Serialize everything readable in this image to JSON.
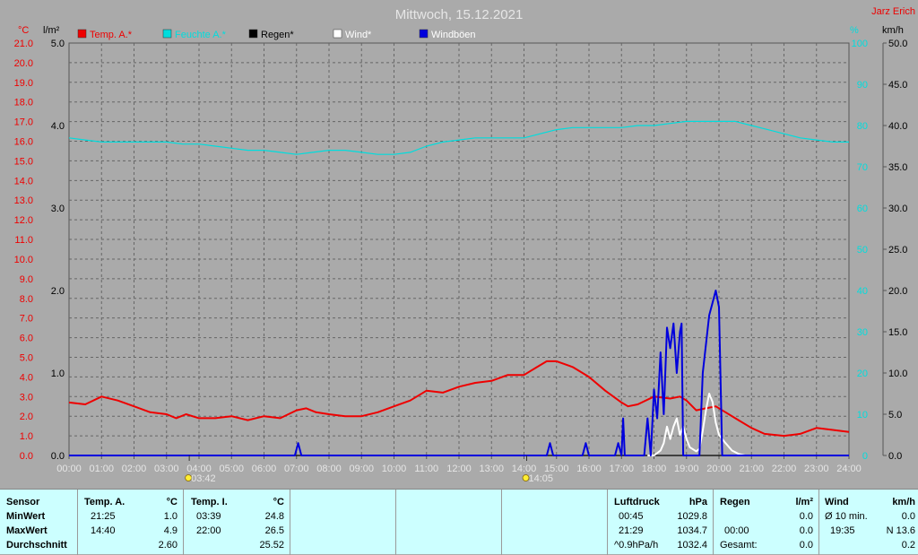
{
  "title": "Mittwoch, 15.12.2021",
  "owner": "Jarz Erich",
  "colors": {
    "temp": "#ee0000",
    "humidity": "#00dddd",
    "rain": "#000000",
    "wind": "#ffffff",
    "gust": "#0000dd"
  },
  "chart_data": {
    "type": "line",
    "x_ticks": [
      "00:00",
      "01:00",
      "02:00",
      "03:00",
      "04:00",
      "05:00",
      "06:00",
      "07:00",
      "08:00",
      "09:00",
      "10:00",
      "11:00",
      "12:00",
      "13:00",
      "14:00",
      "15:00",
      "16:00",
      "17:00",
      "18:00",
      "19:00",
      "20:00",
      "21:00",
      "22:00",
      "23:00",
      "24:00"
    ],
    "axes": {
      "temp": {
        "unit": "°C",
        "range": [
          0,
          21
        ],
        "ticks": [
          "0.0",
          "1.0",
          "2.0",
          "3.0",
          "4.0",
          "5.0",
          "6.0",
          "7.0",
          "8.0",
          "9.0",
          "10.0",
          "11.0",
          "12.0",
          "13.0",
          "14.0",
          "15.0",
          "16.0",
          "17.0",
          "18.0",
          "19.0",
          "20.0",
          "21.0"
        ]
      },
      "rain": {
        "unit": "l/m²",
        "range": [
          0,
          5
        ],
        "ticks": [
          "0.0",
          "1.0",
          "2.0",
          "3.0",
          "4.0",
          "5.0"
        ]
      },
      "humidity": {
        "unit": "%",
        "range": [
          0,
          100
        ],
        "ticks": [
          "0",
          "10",
          "20",
          "30",
          "40",
          "50",
          "60",
          "70",
          "80",
          "90",
          "100"
        ]
      },
      "wind": {
        "unit": "km/h",
        "range": [
          0,
          50
        ],
        "ticks": [
          "0.0",
          "5.0",
          "10.0",
          "15.0",
          "20.0",
          "25.0",
          "30.0",
          "35.0",
          "40.0",
          "45.0",
          "50.0"
        ]
      }
    },
    "grid": true,
    "legend_position": "top",
    "series": [
      {
        "name": "Temp. A.*",
        "axis": "temp",
        "color": "#ee0000",
        "points": [
          [
            0,
            2.7
          ],
          [
            0.5,
            2.6
          ],
          [
            1,
            3.0
          ],
          [
            1.5,
            2.8
          ],
          [
            2,
            2.5
          ],
          [
            2.5,
            2.2
          ],
          [
            3,
            2.1
          ],
          [
            3.3,
            1.9
          ],
          [
            3.6,
            2.1
          ],
          [
            4,
            1.9
          ],
          [
            4.5,
            1.9
          ],
          [
            5,
            2.0
          ],
          [
            5.5,
            1.8
          ],
          [
            6,
            2.0
          ],
          [
            6.5,
            1.9
          ],
          [
            7,
            2.3
          ],
          [
            7.3,
            2.4
          ],
          [
            7.6,
            2.2
          ],
          [
            8,
            2.1
          ],
          [
            8.5,
            2.0
          ],
          [
            9,
            2.0
          ],
          [
            9.5,
            2.2
          ],
          [
            10,
            2.5
          ],
          [
            10.5,
            2.8
          ],
          [
            11,
            3.3
          ],
          [
            11.5,
            3.2
          ],
          [
            12,
            3.5
          ],
          [
            12.5,
            3.7
          ],
          [
            13,
            3.8
          ],
          [
            13.5,
            4.1
          ],
          [
            14,
            4.1
          ],
          [
            14.4,
            4.5
          ],
          [
            14.7,
            4.8
          ],
          [
            15,
            4.8
          ],
          [
            15.5,
            4.5
          ],
          [
            16,
            4.0
          ],
          [
            16.5,
            3.3
          ],
          [
            17,
            2.7
          ],
          [
            17.2,
            2.5
          ],
          [
            17.5,
            2.6
          ],
          [
            18,
            3.0
          ],
          [
            18.5,
            2.9
          ],
          [
            18.8,
            3.0
          ],
          [
            19,
            2.8
          ],
          [
            19.3,
            2.3
          ],
          [
            19.6,
            2.4
          ],
          [
            19.9,
            2.5
          ],
          [
            20.2,
            2.2
          ],
          [
            20.6,
            1.8
          ],
          [
            21,
            1.4
          ],
          [
            21.4,
            1.1
          ],
          [
            22,
            1.0
          ],
          [
            22.5,
            1.1
          ],
          [
            23,
            1.4
          ],
          [
            23.5,
            1.3
          ],
          [
            24,
            1.2
          ]
        ]
      },
      {
        "name": "Feuchte A.*",
        "axis": "humidity",
        "color": "#00dddd",
        "points": [
          [
            0,
            77
          ],
          [
            0.5,
            76.5
          ],
          [
            1,
            76
          ],
          [
            1.5,
            76
          ],
          [
            2,
            76
          ],
          [
            2.5,
            76
          ],
          [
            3,
            76
          ],
          [
            3.5,
            75.5
          ],
          [
            4,
            75.5
          ],
          [
            4.5,
            75
          ],
          [
            5,
            74.5
          ],
          [
            5.5,
            74
          ],
          [
            6,
            74
          ],
          [
            6.5,
            73.5
          ],
          [
            7,
            73
          ],
          [
            7.5,
            73.5
          ],
          [
            8,
            74
          ],
          [
            8.5,
            74
          ],
          [
            9,
            73.5
          ],
          [
            9.5,
            73
          ],
          [
            10,
            73
          ],
          [
            10.5,
            73.5
          ],
          [
            11,
            75
          ],
          [
            11.5,
            76
          ],
          [
            12,
            76.5
          ],
          [
            12.5,
            77
          ],
          [
            13,
            77
          ],
          [
            13.5,
            77
          ],
          [
            14,
            77
          ],
          [
            14.5,
            78
          ],
          [
            15,
            79
          ],
          [
            15.5,
            79.5
          ],
          [
            16,
            79.5
          ],
          [
            16.5,
            79.5
          ],
          [
            17,
            79.5
          ],
          [
            17.5,
            80
          ],
          [
            18,
            80
          ],
          [
            18.5,
            80.5
          ],
          [
            19,
            81
          ],
          [
            19.5,
            81
          ],
          [
            20,
            81
          ],
          [
            20.5,
            81
          ],
          [
            21,
            80
          ],
          [
            21.5,
            79
          ],
          [
            22,
            78
          ],
          [
            22.5,
            77
          ],
          [
            23,
            76.5
          ],
          [
            23.5,
            76
          ],
          [
            24,
            76
          ]
        ]
      },
      {
        "name": "Regen*",
        "axis": "rain",
        "color": "#000000",
        "points": [
          [
            0,
            0
          ],
          [
            24,
            0
          ]
        ]
      },
      {
        "name": "Wind*",
        "axis": "wind",
        "color": "#ffffff",
        "points": [
          [
            17.8,
            0
          ],
          [
            18.0,
            0
          ],
          [
            18.2,
            0.6
          ],
          [
            18.3,
            1.5
          ],
          [
            18.4,
            3.5
          ],
          [
            18.5,
            2.0
          ],
          [
            18.6,
            3.5
          ],
          [
            18.7,
            4.5
          ],
          [
            18.8,
            2.5
          ],
          [
            18.9,
            3.5
          ],
          [
            19.0,
            2.0
          ],
          [
            19.1,
            1.0
          ],
          [
            19.3,
            0.5
          ],
          [
            19.4,
            0.8
          ],
          [
            19.5,
            3.0
          ],
          [
            19.6,
            5.5
          ],
          [
            19.7,
            7.5
          ],
          [
            19.8,
            6.5
          ],
          [
            19.9,
            4.0
          ],
          [
            20.0,
            2.5
          ],
          [
            20.2,
            1.5
          ],
          [
            20.4,
            0.6
          ],
          [
            20.6,
            0.2
          ],
          [
            20.8,
            0
          ],
          [
            21,
            0
          ]
        ]
      },
      {
        "name": "Windböen",
        "axis": "wind",
        "color": "#0000dd",
        "points": [
          [
            0,
            0
          ],
          [
            6.95,
            0
          ],
          [
            7.05,
            1.5
          ],
          [
            7.15,
            0
          ],
          [
            14.7,
            0
          ],
          [
            14.8,
            1.5
          ],
          [
            14.9,
            0
          ],
          [
            15.8,
            0
          ],
          [
            15.9,
            1.5
          ],
          [
            16.0,
            0
          ],
          [
            16.8,
            0
          ],
          [
            16.9,
            1.5
          ],
          [
            17.0,
            0
          ],
          [
            17.05,
            4.5
          ],
          [
            17.1,
            0
          ],
          [
            17.7,
            0
          ],
          [
            17.8,
            4.5
          ],
          [
            17.9,
            0
          ],
          [
            18.0,
            8.0
          ],
          [
            18.1,
            4.5
          ],
          [
            18.2,
            12.5
          ],
          [
            18.3,
            5.0
          ],
          [
            18.4,
            15.5
          ],
          [
            18.5,
            13.0
          ],
          [
            18.6,
            16.0
          ],
          [
            18.7,
            10.0
          ],
          [
            18.8,
            15.0
          ],
          [
            18.85,
            16.0
          ],
          [
            18.9,
            0
          ],
          [
            19.4,
            0
          ],
          [
            19.5,
            10.0
          ],
          [
            19.6,
            13.5
          ],
          [
            19.7,
            17.0
          ],
          [
            19.8,
            18.5
          ],
          [
            19.9,
            20.0
          ],
          [
            20.0,
            18.0
          ],
          [
            20.1,
            0
          ],
          [
            24,
            0
          ]
        ]
      }
    ],
    "markers": [
      {
        "x": 3.7,
        "label": "03:42"
      },
      {
        "x": 14.083,
        "label": "14:05"
      }
    ]
  },
  "stats": {
    "sensor": {
      "header": "Sensor",
      "rows": [
        "MinWert",
        "MaxWert",
        "Durchschnitt"
      ]
    },
    "temp_a": {
      "header": "Temp. A.",
      "unit": "°C",
      "min_time": "21:25",
      "min": "1.0",
      "max_time": "14:40",
      "max": "4.9",
      "avg": "2.60"
    },
    "temp_i": {
      "header": "Temp. I.",
      "unit": "°C",
      "min_time": "03:39",
      "min": "24.8",
      "max_time": "22:00",
      "max": "26.5",
      "avg": "25.52"
    },
    "pressure": {
      "header": "Luftdruck",
      "unit": "hPa",
      "min_time": "00:45",
      "min": "1029.8",
      "max_time": "21:29",
      "max": "1034.7",
      "trend": "^0.9hPa/h",
      "trend_value": "1032.4"
    },
    "rain": {
      "header": "Regen",
      "unit": "l/m²",
      "blank": "",
      "value1": "0.0",
      "time2": "00:00",
      "value2": "0.0",
      "label3": "Gesamt:",
      "value3": "0.0"
    },
    "wind": {
      "header": "Wind",
      "unit": "km/h",
      "label1": "Ø 10 min.",
      "value1": "0.0",
      "time2": "19:35",
      "value2": "N 13.6",
      "value3": "0.2"
    }
  }
}
